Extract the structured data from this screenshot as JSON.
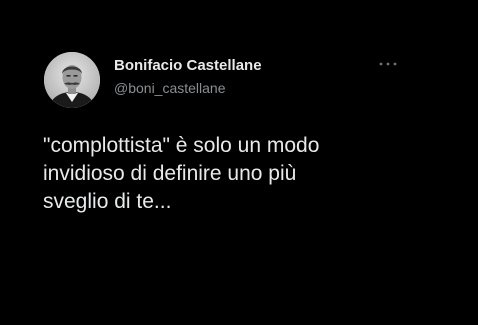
{
  "tweet": {
    "author": {
      "display_name": "Bonifacio Castellane",
      "handle": "@boni_castellane",
      "avatar_icon": "portrait-avatar"
    },
    "more_icon": "more-dots-icon",
    "text": "\"complottista\" è solo un modo\ninvidioso di definire uno più\nsveglio di te..."
  },
  "colors": {
    "background": "#000000",
    "text": "#e7e9ea",
    "secondary_text": "#8b8f94"
  }
}
